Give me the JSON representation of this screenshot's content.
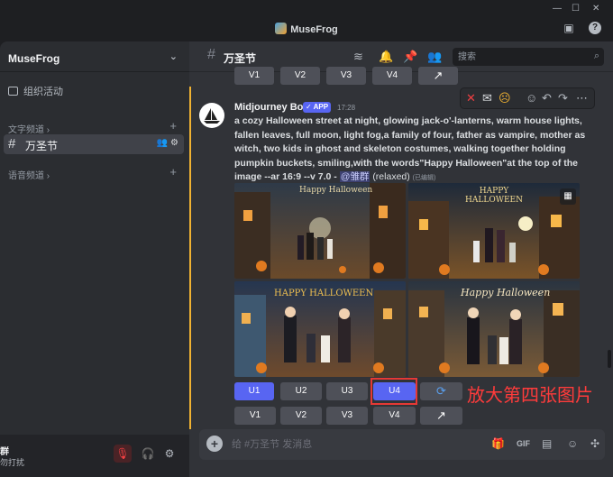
{
  "app": {
    "title": "MuseFrog"
  },
  "window_controls": [
    "—",
    "☐",
    "✕"
  ],
  "sidebar": {
    "server_name": "MuseFrog",
    "events_label": "组织活动",
    "text_category": "文字频道",
    "active_channel": "万圣节",
    "voice_category": "语音频道"
  },
  "user": {
    "name": "群",
    "status": "勿打扰"
  },
  "channel": {
    "name": "万圣节",
    "search_placeholder": "搜索"
  },
  "prev_buttons": [
    "V1",
    "V2",
    "V3",
    "V4"
  ],
  "message": {
    "author": "Midjourney Bot",
    "badge": "APP",
    "time": "17:28",
    "prompt": "a cozy Halloween street at night, glowing jack-o'-lanterns, warm house lights, fallen leaves, full moon, light fog,a family of four, father as vampire, mother as witch, two kids in ghost and skeleton costumes, walking together holding pumpkin buckets, smiling,with the words\"Happy Halloween\"at the top of the image --ar 16:9 --v 7.0 - ",
    "mention": "@雏群",
    "mode": "(relaxed)",
    "edited": "(已编辑)"
  },
  "grid_titles": [
    "Happy Halloween",
    "HAPPY HALLOWEEN",
    "HAPPY HALLOWEEN",
    "Happy Halloween"
  ],
  "upscale_buttons": [
    "U1",
    "U2",
    "U3",
    "U4"
  ],
  "variation_buttons": [
    "V1",
    "V2",
    "V3",
    "V4"
  ],
  "annotation": "放大第四张图片",
  "composer": {
    "placeholder": "给 #万圣节 发消息"
  },
  "colors": {
    "accent": "#5865f2",
    "highlight": "#e53935",
    "mention_bar": "#f0b232"
  }
}
